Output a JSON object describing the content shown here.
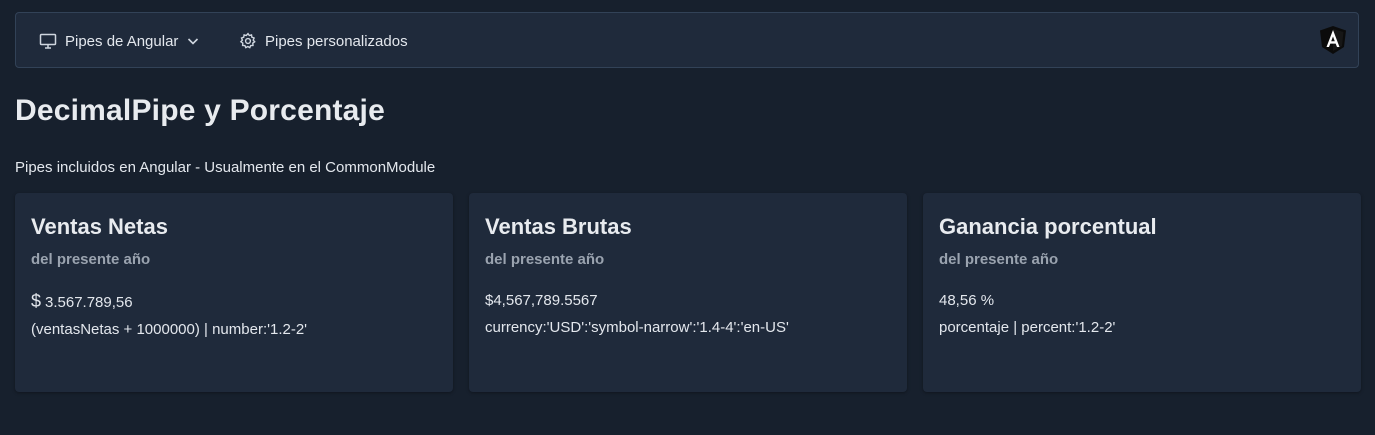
{
  "menubar": {
    "items": [
      {
        "label": "Pipes de Angular",
        "icon": "desktop-icon",
        "has_dropdown": true
      },
      {
        "label": "Pipes personalizados",
        "icon": "gear-icon",
        "has_dropdown": false
      }
    ],
    "logo": "angular-logo"
  },
  "page": {
    "title": "DecimalPipe y Porcentaje",
    "subtitle": "Pipes incluidos en Angular - Usualmente en el CommonModule"
  },
  "cards": [
    {
      "title": "Ventas Netas",
      "subtitle": "del presente año",
      "value_symbol": "$",
      "value": "3.567.789,56",
      "expression": "(ventasNetas + 1000000) | number:'1.2-2'"
    },
    {
      "title": "Ventas Brutas",
      "subtitle": "del presente año",
      "value": "$4,567,789.5567",
      "expression": "currency:'USD':'symbol-narrow':'1.4-4':'en-US'"
    },
    {
      "title": "Ganancia porcentual",
      "subtitle": "del presente año",
      "value": "48,56 %",
      "expression": "porcentaje | percent:'1.2-2'"
    }
  ],
  "colors": {
    "background": "#17202d",
    "surface": "#1f2a3b",
    "text": "#e3e7ed",
    "muted": "#9aa3af"
  }
}
